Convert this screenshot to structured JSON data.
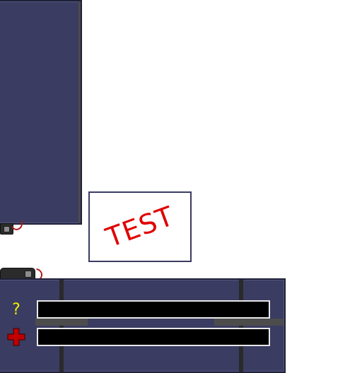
{
  "sign": {
    "text": "TEST",
    "color": "#e00000"
  },
  "status": {
    "unknown_symbol": "?",
    "icons": [
      "question-mark-icon",
      "red-cross-health-icon"
    ],
    "bars": [
      {
        "name": "status-bar-unknown",
        "fill_percent": 0
      },
      {
        "name": "status-bar-health",
        "fill_percent": 0
      }
    ]
  },
  "colors": {
    "panel": "#3a3c62",
    "bar_bg": "#000000",
    "bar_border": "#e8e8e8",
    "health_cross": "#c00000",
    "question_mark": "#f0f000"
  }
}
